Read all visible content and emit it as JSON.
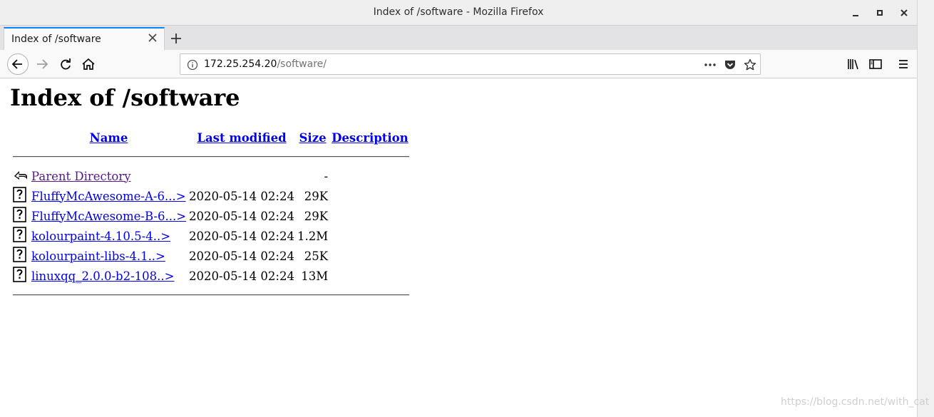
{
  "window": {
    "title": "Index of /software - Mozilla Firefox"
  },
  "tab": {
    "label": "Index of /software"
  },
  "urlbar": {
    "host": "172.25.254.20",
    "path": "/software/"
  },
  "page": {
    "heading": "Index of /software",
    "columns": {
      "name": "Name",
      "last_modified": "Last modified",
      "size": "Size",
      "description": "Description"
    },
    "parent": {
      "label": "Parent Directory",
      "size": "-"
    },
    "files": [
      {
        "name": "FluffyMcAwesome-A-6...>",
        "modified": "2020-05-14 02:24",
        "size": "29K"
      },
      {
        "name": "FluffyMcAwesome-B-6...>",
        "modified": "2020-05-14 02:24",
        "size": "29K"
      },
      {
        "name": "kolourpaint-4.10.5-4..>",
        "modified": "2020-05-14 02:24",
        "size": "1.2M"
      },
      {
        "name": "kolourpaint-libs-4.1..>",
        "modified": "2020-05-14 02:24",
        "size": "25K"
      },
      {
        "name": "linuxqq_2.0.0-b2-108..>",
        "modified": "2020-05-14 02:24",
        "size": "13M"
      }
    ]
  },
  "watermark": "https://blog.csdn.net/with_cat"
}
